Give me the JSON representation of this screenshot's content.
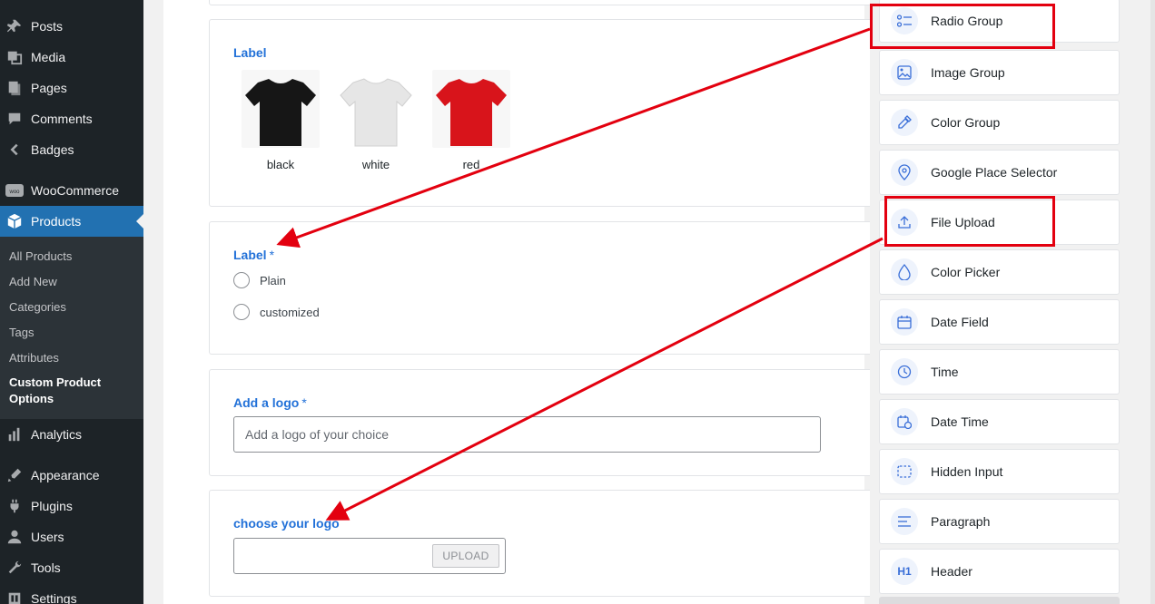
{
  "sidebar": {
    "items": [
      {
        "label": "Posts",
        "icon": "pin-icon"
      },
      {
        "label": "Media",
        "icon": "media-icon"
      },
      {
        "label": "Pages",
        "icon": "pages-icon"
      },
      {
        "label": "Comments",
        "icon": "comments-icon"
      },
      {
        "label": "Badges",
        "icon": "badges-icon"
      },
      {
        "label": "WooCommerce",
        "icon": "woocommerce-icon"
      },
      {
        "label": "Products",
        "icon": "products-icon"
      },
      {
        "label": "Analytics",
        "icon": "analytics-icon"
      },
      {
        "label": "Appearance",
        "icon": "appearance-icon"
      },
      {
        "label": "Plugins",
        "icon": "plugins-icon"
      },
      {
        "label": "Users",
        "icon": "users-icon"
      },
      {
        "label": "Tools",
        "icon": "tools-icon"
      },
      {
        "label": "Settings",
        "icon": "settings-icon"
      }
    ],
    "submenu": [
      {
        "label": "All Products"
      },
      {
        "label": "Add New"
      },
      {
        "label": "Categories"
      },
      {
        "label": "Tags"
      },
      {
        "label": "Attributes"
      },
      {
        "label": "Custom Product Options"
      }
    ]
  },
  "form": {
    "image_group": {
      "label": "Label",
      "options": [
        {
          "caption": "black",
          "color": "#161616"
        },
        {
          "caption": "white",
          "color": "#e6e6e6"
        },
        {
          "caption": "red",
          "color": "#d8141b"
        }
      ]
    },
    "radio_group": {
      "label": "Label",
      "required_mark": "*",
      "options": [
        {
          "label": "Plain"
        },
        {
          "label": "customized"
        }
      ]
    },
    "text_field": {
      "label": "Add a logo",
      "required_mark": "*",
      "placeholder": "Add a logo of your choice"
    },
    "file_field": {
      "label": "choose your logo",
      "button": "UPLOAD"
    }
  },
  "palette": {
    "items": [
      {
        "label": "Radio Group",
        "icon": "radio-list-icon"
      },
      {
        "label": "Image Group",
        "icon": "image-icon"
      },
      {
        "label": "Color Group",
        "icon": "eyedropper-icon"
      },
      {
        "label": "Google Place Selector",
        "icon": "location-pin-icon"
      },
      {
        "label": "File Upload",
        "icon": "upload-icon"
      },
      {
        "label": "Color Picker",
        "icon": "droplet-icon"
      },
      {
        "label": "Date Field",
        "icon": "calendar-icon"
      },
      {
        "label": "Time",
        "icon": "clock-icon"
      },
      {
        "label": "Date Time",
        "icon": "calendar-clock-icon"
      },
      {
        "label": "Hidden Input",
        "icon": "dashed-box-icon"
      },
      {
        "label": "Paragraph",
        "icon": "paragraph-lines-icon"
      },
      {
        "label": "Header",
        "icon": "h1-icon",
        "glyph": "H1"
      }
    ]
  },
  "colors": {
    "sidebar_bg": "#1d2327",
    "active_menu": "#2271b1",
    "field_label": "#2271d8",
    "annotation": "#e3000f"
  }
}
